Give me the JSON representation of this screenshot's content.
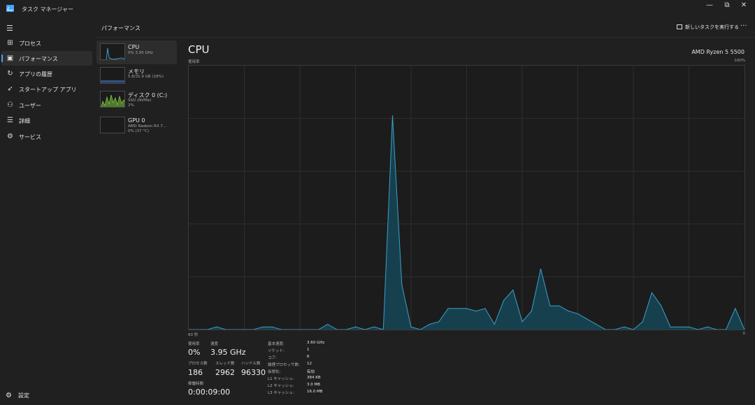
{
  "window": {
    "title": "タスク マネージャー",
    "controls": [
      "—",
      "⧉",
      "✕"
    ]
  },
  "nav": {
    "items": [
      {
        "label": "プロセス",
        "icon": "processes-icon",
        "glyph": "⊞"
      },
      {
        "label": "パフォーマンス",
        "icon": "performance-icon",
        "glyph": "▣",
        "active": true
      },
      {
        "label": "アプリの履歴",
        "icon": "app-history-icon",
        "glyph": "↻"
      },
      {
        "label": "スタートアップ アプリ",
        "icon": "startup-icon",
        "glyph": "➶"
      },
      {
        "label": "ユーザー",
        "icon": "users-icon",
        "glyph": "⚇"
      },
      {
        "label": "詳細",
        "icon": "details-icon",
        "glyph": "☰"
      },
      {
        "label": "サービス",
        "icon": "services-icon",
        "glyph": "⚙"
      }
    ],
    "settings_label": "設定"
  },
  "header": {
    "title": "パフォーマンス",
    "run_task_label": "新しいタスクを実行する",
    "more_label": "···"
  },
  "resources": [
    {
      "name": "CPU",
      "sub": "0% 3.95 GHz",
      "active": true
    },
    {
      "name": "メモリ",
      "sub": "5.8/31.9 GB (18%)"
    },
    {
      "name": "ディスク 0 (C:)",
      "sub1": "SSD (NVMe)",
      "sub2": "2%"
    },
    {
      "name": "GPU 0",
      "sub1": "AMD Radeon RX 7...",
      "sub2": "0% (37 °C)"
    }
  ],
  "detail": {
    "title": "CPU",
    "model": "AMD Ryzen 5 5500",
    "y_axis_label": "使用率",
    "y_max_label": "100%",
    "x_left_label": "60 秒",
    "x_right_label": "0"
  },
  "chart_data": {
    "type": "area",
    "ylabel": "使用率",
    "ylim": [
      0,
      100
    ],
    "x_range_seconds": [
      60,
      0
    ],
    "grid": true,
    "x": [
      60,
      59,
      58,
      57,
      56,
      55,
      54,
      53,
      52,
      51,
      50,
      49,
      48,
      47,
      46,
      45,
      44,
      43,
      42,
      41,
      40,
      39,
      38,
      37,
      36,
      35,
      34,
      33,
      32,
      31,
      30,
      29,
      28,
      27,
      26,
      25,
      24,
      23,
      22,
      21,
      20,
      19,
      18,
      17,
      16,
      15,
      14,
      13,
      12,
      11,
      10,
      9,
      8,
      7,
      6,
      5,
      4,
      3,
      2,
      1,
      0
    ],
    "values": [
      0,
      0,
      0,
      1,
      0,
      0,
      0,
      0,
      1,
      1,
      0,
      0,
      0,
      0,
      0,
      2,
      0,
      0,
      1,
      0,
      1,
      0,
      81,
      17,
      1,
      0,
      2,
      3,
      8,
      8,
      8,
      7,
      8,
      2,
      11,
      15,
      3,
      7,
      23,
      9,
      9,
      7,
      6,
      4,
      2,
      0,
      0,
      1,
      0,
      3,
      14,
      9,
      1,
      1,
      1,
      0,
      1,
      0,
      0,
      8,
      0
    ]
  },
  "stats": {
    "usage_label": "使用率",
    "usage_value": "0%",
    "speed_label": "速度",
    "speed_value": "3.95 GHz",
    "processes_label": "プロセス数",
    "processes_value": "186",
    "threads_label": "スレッド数",
    "threads_value": "2962",
    "handles_label": "ハンドル数",
    "handles_value": "96330",
    "uptime_label": "稼働時間",
    "uptime_value": "0:00:09:00"
  },
  "specs": [
    {
      "label": "基本速度:",
      "value": "3.60 GHz"
    },
    {
      "label": "ソケット:",
      "value": "1"
    },
    {
      "label": "コア:",
      "value": "6"
    },
    {
      "label": "論理プロセッサ数:",
      "value": "12"
    },
    {
      "label": "仮想化:",
      "value": "有効"
    },
    {
      "label": "L1 キャッシュ:",
      "value": "384 KB"
    },
    {
      "label": "L2 キャッシュ:",
      "value": "3.0 MB"
    },
    {
      "label": "L3 キャッシュ:",
      "value": "16.0 MB"
    }
  ],
  "colors": {
    "accent": "#4aa3ff",
    "cpu_line": "#3aa0c8",
    "cpu_fill": "#17404f",
    "disk_fill": "#6aa33a",
    "background": "#202020"
  }
}
